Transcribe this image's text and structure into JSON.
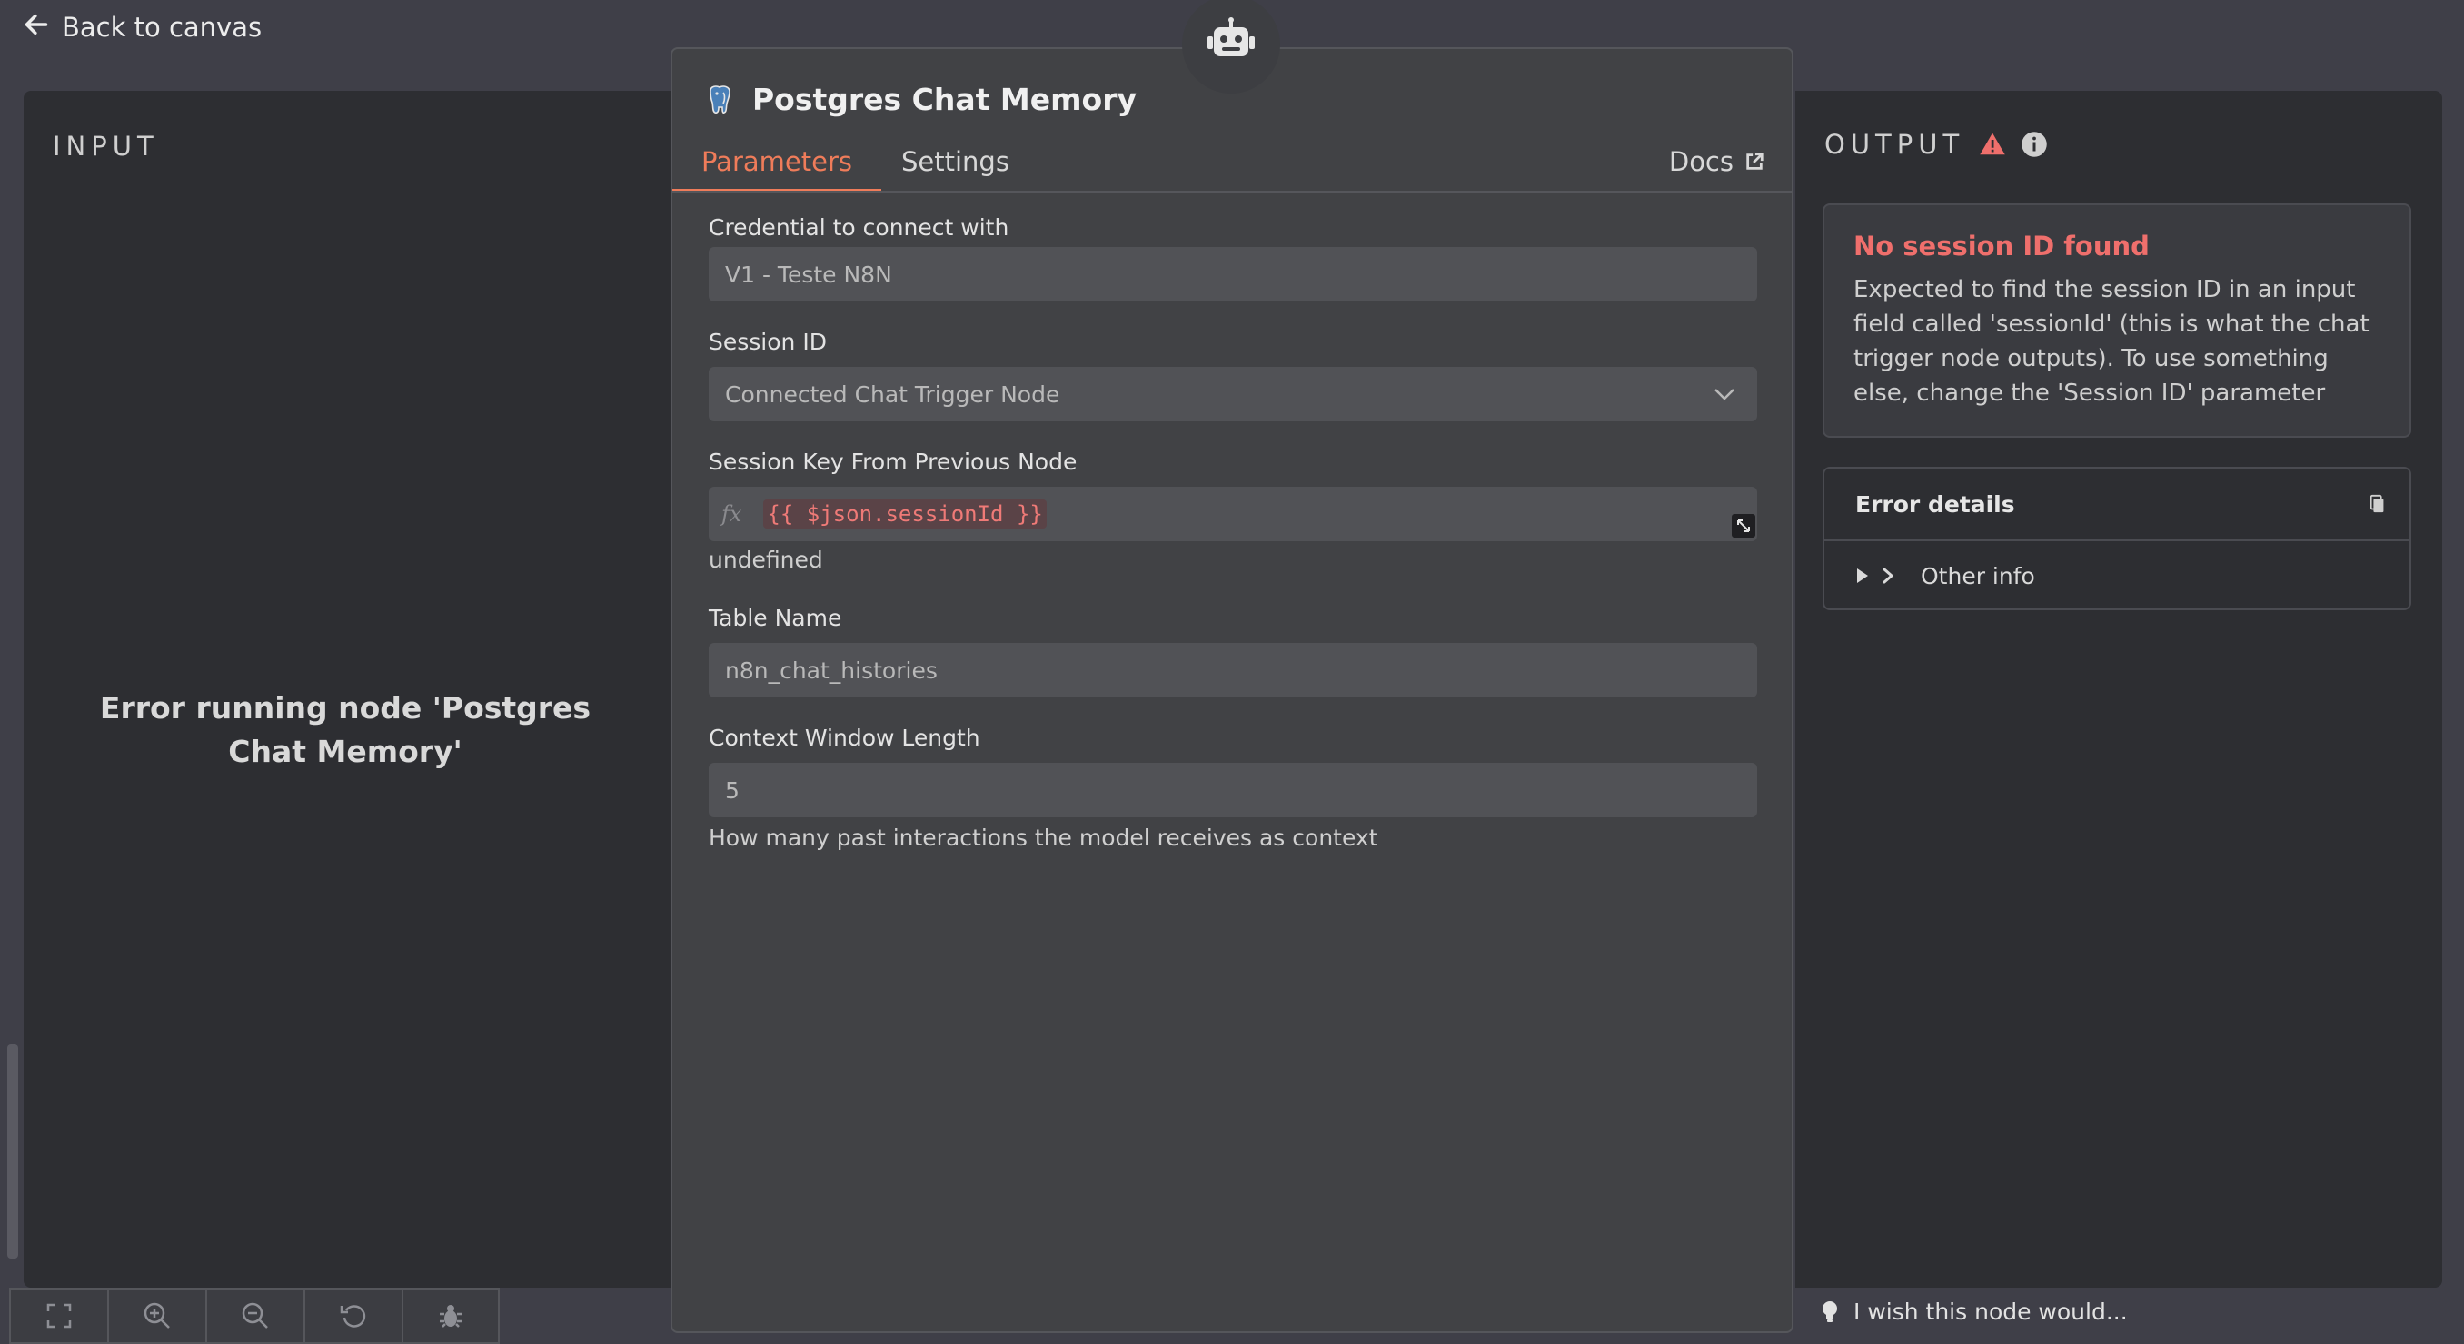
{
  "nav": {
    "back_label": "Back to canvas"
  },
  "input_panel": {
    "label": "INPUT",
    "error_message": "Error running node 'Postgres Chat Memory'"
  },
  "node": {
    "title": "Postgres Chat Memory",
    "icon": "postgres-elephant-icon"
  },
  "tabs": {
    "parameters": "Parameters",
    "settings": "Settings",
    "docs": "Docs"
  },
  "fields": {
    "credential": {
      "label": "Credential to connect with",
      "value": "V1 - Teste N8N"
    },
    "session_id": {
      "label": "Session ID",
      "value": "Connected Chat Trigger Node"
    },
    "session_key": {
      "label": "Session Key From Previous Node",
      "fx": "fx",
      "expression": "{{ $json.sessionId }}",
      "result": "undefined"
    },
    "table_name": {
      "label": "Table Name",
      "value": "n8n_chat_histories"
    },
    "context_window": {
      "label": "Context Window Length",
      "value": "5",
      "hint": "How many past interactions the model receives as context"
    }
  },
  "output_panel": {
    "label": "OUTPUT",
    "error_title": "No session ID found",
    "error_description": "Expected to find the session ID in an input field called 'sessionId' (this is what the chat trigger node outputs). To use something else, change the 'Session ID' parameter",
    "details_title": "Error details",
    "other_info": "Other info"
  },
  "feedback": {
    "label": "I wish this node would..."
  },
  "toolbar": [
    "fit-view-icon",
    "zoom-in-icon",
    "zoom-out-icon",
    "reset-zoom-icon",
    "debug-icon"
  ],
  "colors": {
    "accent": "#ef7c5a",
    "error": "#ef6f6c",
    "background": "#3f3f48",
    "panel": "#2d2e32",
    "modal": "#414245"
  }
}
